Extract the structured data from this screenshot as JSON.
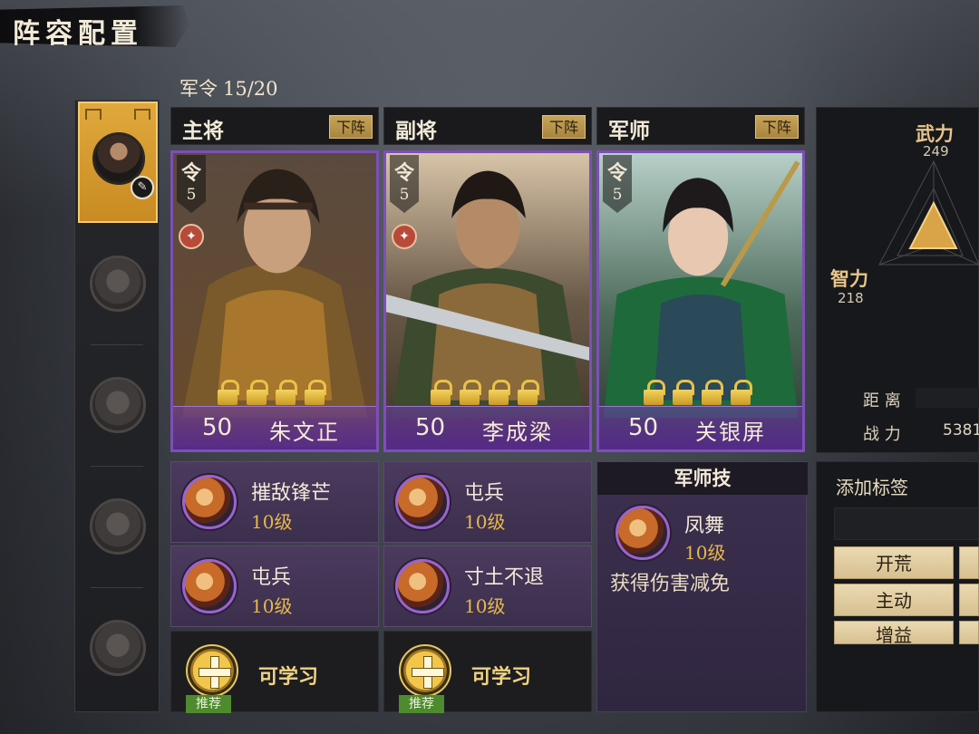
{
  "header": {
    "title": "阵容配置",
    "order_label": "军令",
    "order_value": "15/20"
  },
  "roles": [
    {
      "role": "主将",
      "action": "下阵"
    },
    {
      "role": "副将",
      "action": "下阵"
    },
    {
      "role": "军师",
      "action": "下阵"
    }
  ],
  "cards": [
    {
      "badge": "令",
      "cost": "5",
      "level": "50",
      "name": "朱文正",
      "type_icon": "feather-icon",
      "locks": 4
    },
    {
      "badge": "令",
      "cost": "5",
      "level": "50",
      "name": "李成梁",
      "type_icon": "feather-icon",
      "locks": 4
    },
    {
      "badge": "令",
      "cost": "5",
      "level": "50",
      "name": "关银屏",
      "type_icon": "",
      "locks": 4
    }
  ],
  "skills": {
    "col1": [
      {
        "name": "摧敌锋芒",
        "level": "10级"
      },
      {
        "name": "屯兵",
        "level": "10级"
      }
    ],
    "col2": [
      {
        "name": "屯兵",
        "level": "10级"
      },
      {
        "name": "寸土不退",
        "level": "10级"
      }
    ],
    "learn_label": "可学习",
    "recommend": "推荐"
  },
  "strategist": {
    "title": "军师技",
    "skill_name": "凤舞",
    "skill_level": "10级",
    "description": "获得伤害减免"
  },
  "stats": {
    "force_label": "武力",
    "force_value": "249",
    "intel_label": "智力",
    "intel_value": "218",
    "distance_label": "距 离",
    "distance_value": "",
    "power_label": "战 力",
    "power_value": "5381"
  },
  "tags": {
    "title": "添加标签",
    "buttons": [
      "开荒",
      "主动",
      "增益"
    ]
  },
  "colors": {
    "accent_gold": "#d9a33a",
    "card_purple": "#7d4fb8",
    "level_gold": "#e6b84a"
  }
}
